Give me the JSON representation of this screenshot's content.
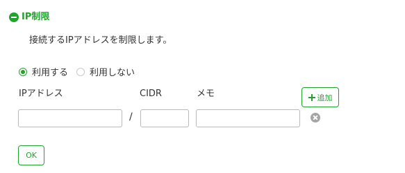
{
  "section": {
    "title": "IP制限",
    "description": "接続するIPアドレスを制限します。"
  },
  "restriction": {
    "options": [
      {
        "label": "利用する",
        "checked": true
      },
      {
        "label": "利用しない",
        "checked": false
      }
    ]
  },
  "columns": {
    "ip_label": "IPアドレス",
    "cidr_label": "CIDR",
    "memo_label": "メモ"
  },
  "row": {
    "ip_value": "",
    "cidr_value": "",
    "memo_value": "",
    "separator": "/"
  },
  "buttons": {
    "add_label": "追加",
    "ok_label": "OK"
  },
  "icons": {
    "collapse": "minus-circle-icon",
    "add": "plus-icon",
    "remove": "x-circle-icon"
  },
  "colors": {
    "accent": "#21a42c",
    "remove_icon": "#a5a5a5"
  }
}
